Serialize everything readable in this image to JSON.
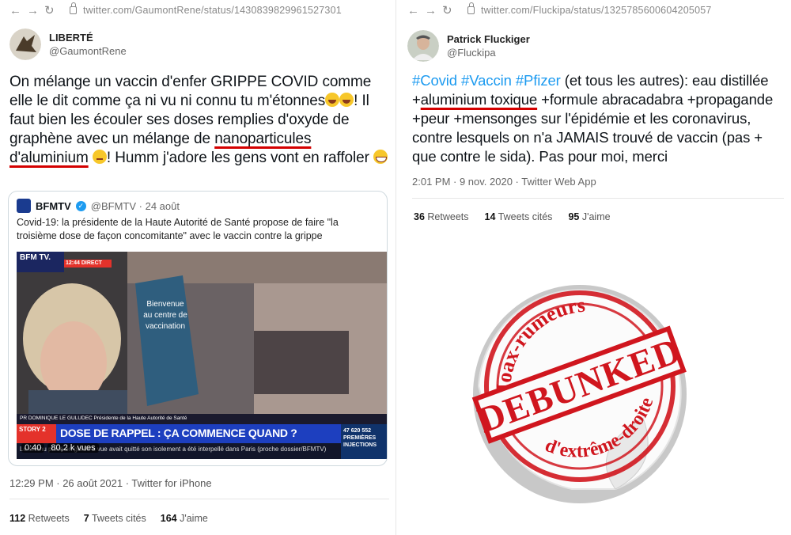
{
  "left": {
    "url": "twitter.com/GaumontRene/status/1430839829961527301",
    "author": {
      "name": "LIBERTÉ",
      "handle": "@GaumontRene"
    },
    "tweet": {
      "p1": "On mélange un vaccin d'enfer GRIPPE COVID comme elle le dit comme ça ni vu ni connu tu m'étonnes",
      "p2": "! Il faut bien les écouler ses doses remplies d'oxyde de graphène avec un mélange de ",
      "u1": "nanoparticules",
      "u2": "d'aluminium",
      "p3": "! Humm j'adore les gens vont en raffoler"
    },
    "quote": {
      "name": "BFMTV",
      "handle": "@BFMTV · 24 août",
      "text": "Covid-19: la présidente de la Haute Autorité de Santé propose de faire \"la troisième dose de façon concomitante\" avec le vaccin contre la grippe",
      "video": {
        "logo": "BFM TV.",
        "live": "12:44 DIRECT",
        "sign": "Bienvenue au centre de vaccination",
        "caption": "PR DOMINIQUE LE GULUDEC   Présidente de la Haute Autorité de Santé",
        "story": "STORY 2",
        "headline": "DOSE DE RAPPEL : ÇA COMMENCE QUAND ?",
        "ticker": "Le retenu placé en garde à vue avait quitté son isolement a été interpellé dans Paris (proche dossier/BFMTV)",
        "counter": "47 620 552 PREMIÈRES INJECTIONS",
        "time": "0:40",
        "views": "80,2 k vues"
      }
    },
    "meta": "12:29 PM · 26 août 2021 · Twitter for iPhone",
    "stats": {
      "retweets_n": "112",
      "retweets_l": "Retweets",
      "quotes_n": "7",
      "quotes_l": "Tweets cités",
      "likes_n": "164",
      "likes_l": "J'aime"
    }
  },
  "right": {
    "url": "twitter.com/Fluckipa/status/1325785600604205057",
    "author": {
      "name": "Patrick Fluckiger",
      "handle": "@Fluckipa"
    },
    "tweet": {
      "h1": "#Covid",
      "h2": "#Vaccin",
      "h3": "#Pfizer",
      "p1": " (et tous les autres): eau distillée +",
      "u1": "aluminium toxique",
      "p2": " +formule abracadabra +propagande +peur +mensonges sur l'épidémie et les coronavirus, contre lesquels on n'a JAMAIS trouvé de vaccin (pas + que contre le sida). Pas pour moi, merci"
    },
    "meta": "2:01 PM · 9 nov. 2020 · Twitter Web App",
    "stats": {
      "retweets_n": "36",
      "retweets_l": "Retweets",
      "quotes_n": "14",
      "quotes_l": "Tweets cités",
      "likes_n": "95",
      "likes_l": "J'aime"
    },
    "stamp": {
      "top": "Hoax-rumeurs",
      "center": "DEBUNKED",
      "bottom": "d'extrême-droite",
      "color": "#d0161e"
    }
  }
}
